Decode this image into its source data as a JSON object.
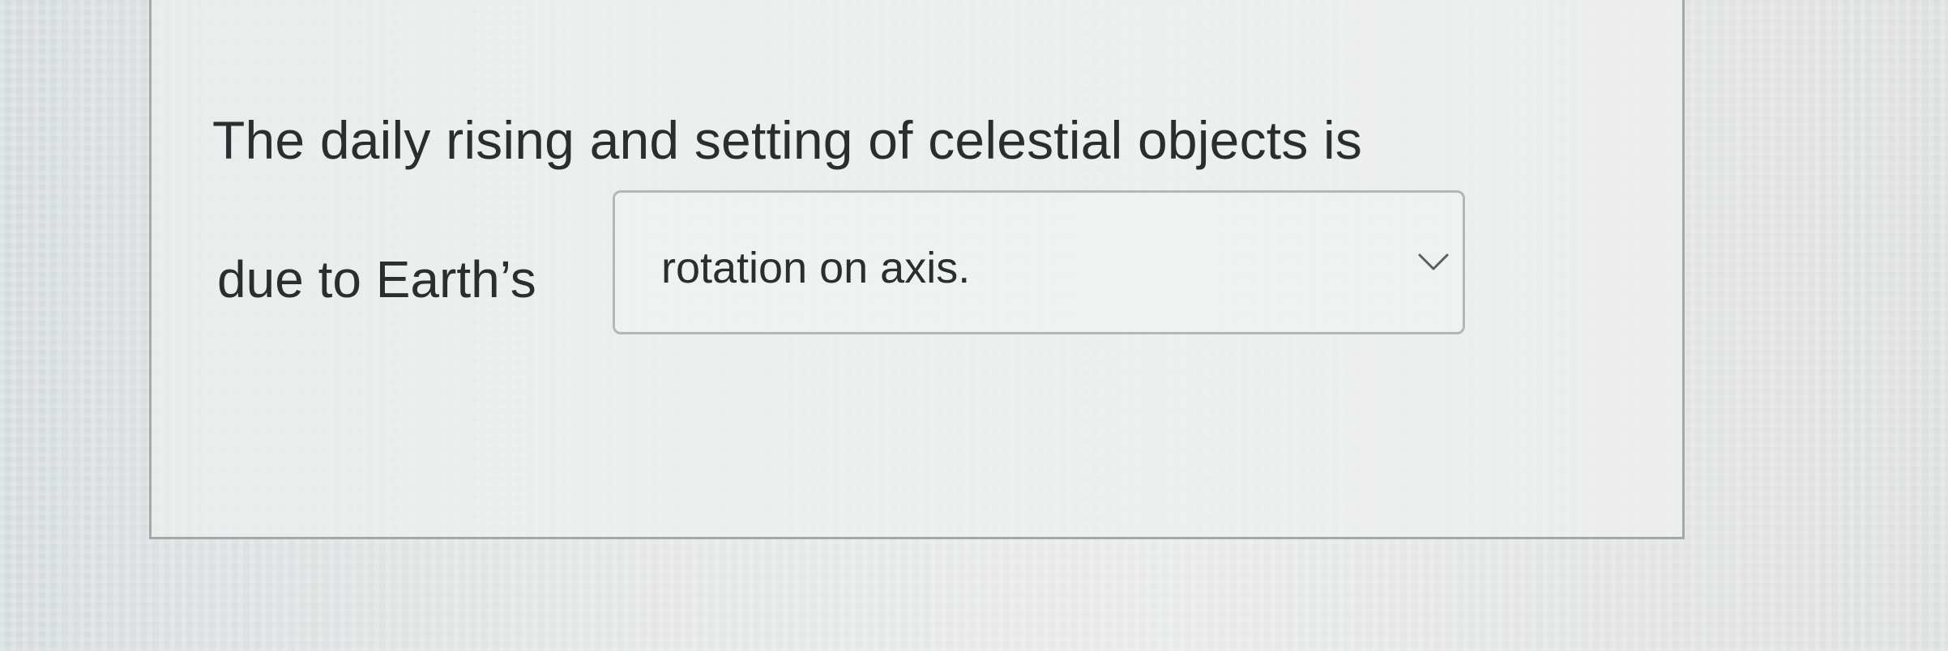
{
  "question": {
    "line1": "The daily rising and setting of celestial objects is",
    "line2_prefix": "due to Earth’s"
  },
  "dropdown": {
    "selected_value": "rotation on axis.",
    "icon": "chevron-down-icon"
  },
  "colors": {
    "text": "#2b2d2f",
    "panel_border": "#a3a8ab",
    "dropdown_border": "#b3b7ba"
  }
}
